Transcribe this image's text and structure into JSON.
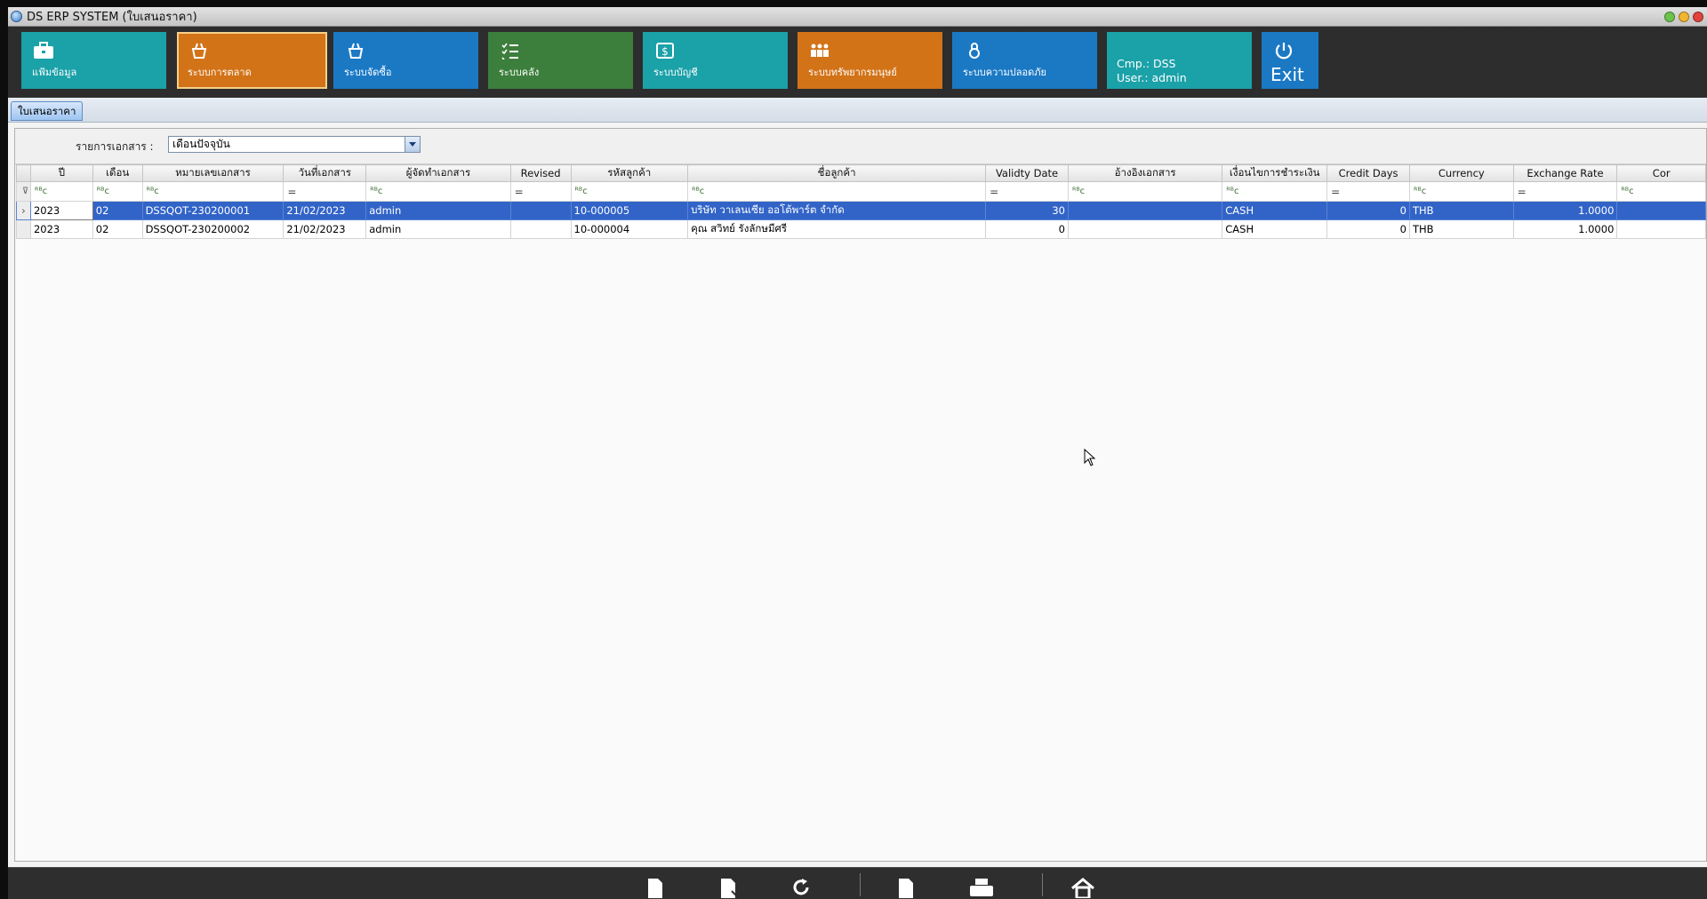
{
  "window": {
    "title": "DS ERP SYSTEM  (ใบเสนอราคา)"
  },
  "ribbon": {
    "tiles": [
      {
        "label": "แฟ้มข้อมูล",
        "icon": "briefcase-icon",
        "color": "#1ba1a8"
      },
      {
        "label": "ระบบการตลาด",
        "icon": "basket-icon",
        "color": "#d27318",
        "active": true
      },
      {
        "label": "ระบบจัดซื้อ",
        "icon": "basket-icon",
        "color": "#1b79c4"
      },
      {
        "label": "ระบบคลัง",
        "icon": "checklist-icon",
        "color": "#3c7f3c"
      },
      {
        "label": "ระบบบัญชี",
        "icon": "money-icon",
        "color": "#1ba1a8"
      },
      {
        "label": "ระบบทรัพยากรมนุษย์",
        "icon": "people-icon",
        "color": "#d27318"
      },
      {
        "label": "ระบบความปลอดภัย",
        "icon": "lock-icon",
        "color": "#1b79c4"
      }
    ],
    "info": {
      "company": "Cmp.: DSS",
      "user": "User.: admin",
      "color": "#1ba1a8"
    },
    "exit": {
      "label": "Exit",
      "icon": "exit-icon",
      "color": "#1b79c4"
    }
  },
  "tab": {
    "label": "ใบเสนอราคา"
  },
  "filter": {
    "label": "รายการเอกสาร :",
    "value": "เดือนปัจจุบัน"
  },
  "grid": {
    "columns": [
      "ปี",
      "เดือน",
      "หมายเลขเอกสาร",
      "วันที่เอกสาร",
      "ผู้จัดทำเอกสาร",
      "Revised",
      "รหัสลูกค้า",
      "ชื่อลูกค้า",
      "Validty Date",
      "อ้างอิงเอกสาร",
      "เงื่อนไขการชำระเงิน",
      "Credit Days",
      "Currency",
      "Exchange Rate",
      "Cor"
    ],
    "filter_symbols": [
      "ᴿᴮc",
      "ᴿᴮc",
      "ᴿᴮc",
      "=",
      "ᴿᴮc",
      "=",
      "ᴿᴮc",
      "ᴿᴮc",
      "=",
      "ᴿᴮc",
      "ᴿᴮc",
      "=",
      "ᴿᴮc",
      "=",
      "ᴿᴮc"
    ],
    "rows": [
      [
        "2023",
        "02",
        "DSSQOT-230200001",
        "21/02/2023",
        "admin",
        "",
        "10-000005",
        "บริษัท วาเลนเซีย ออโต้พาร์ต จำกัด",
        "30",
        "",
        "CASH",
        "0",
        "THB",
        "1.0000",
        ""
      ],
      [
        "2023",
        "02",
        "DSSQOT-230200002",
        "21/02/2023",
        "admin",
        "",
        "10-000004",
        "คุณ สวิทย์ รังลักษมีศรี",
        "0",
        "",
        "CASH",
        "0",
        "THB",
        "1.0000",
        ""
      ]
    ],
    "selected_row": 0
  },
  "bottombar": {
    "icons": [
      "new-doc-icon",
      "edit-doc-icon",
      "refresh-icon",
      "doc-icon",
      "print-icon",
      "home-icon"
    ]
  }
}
